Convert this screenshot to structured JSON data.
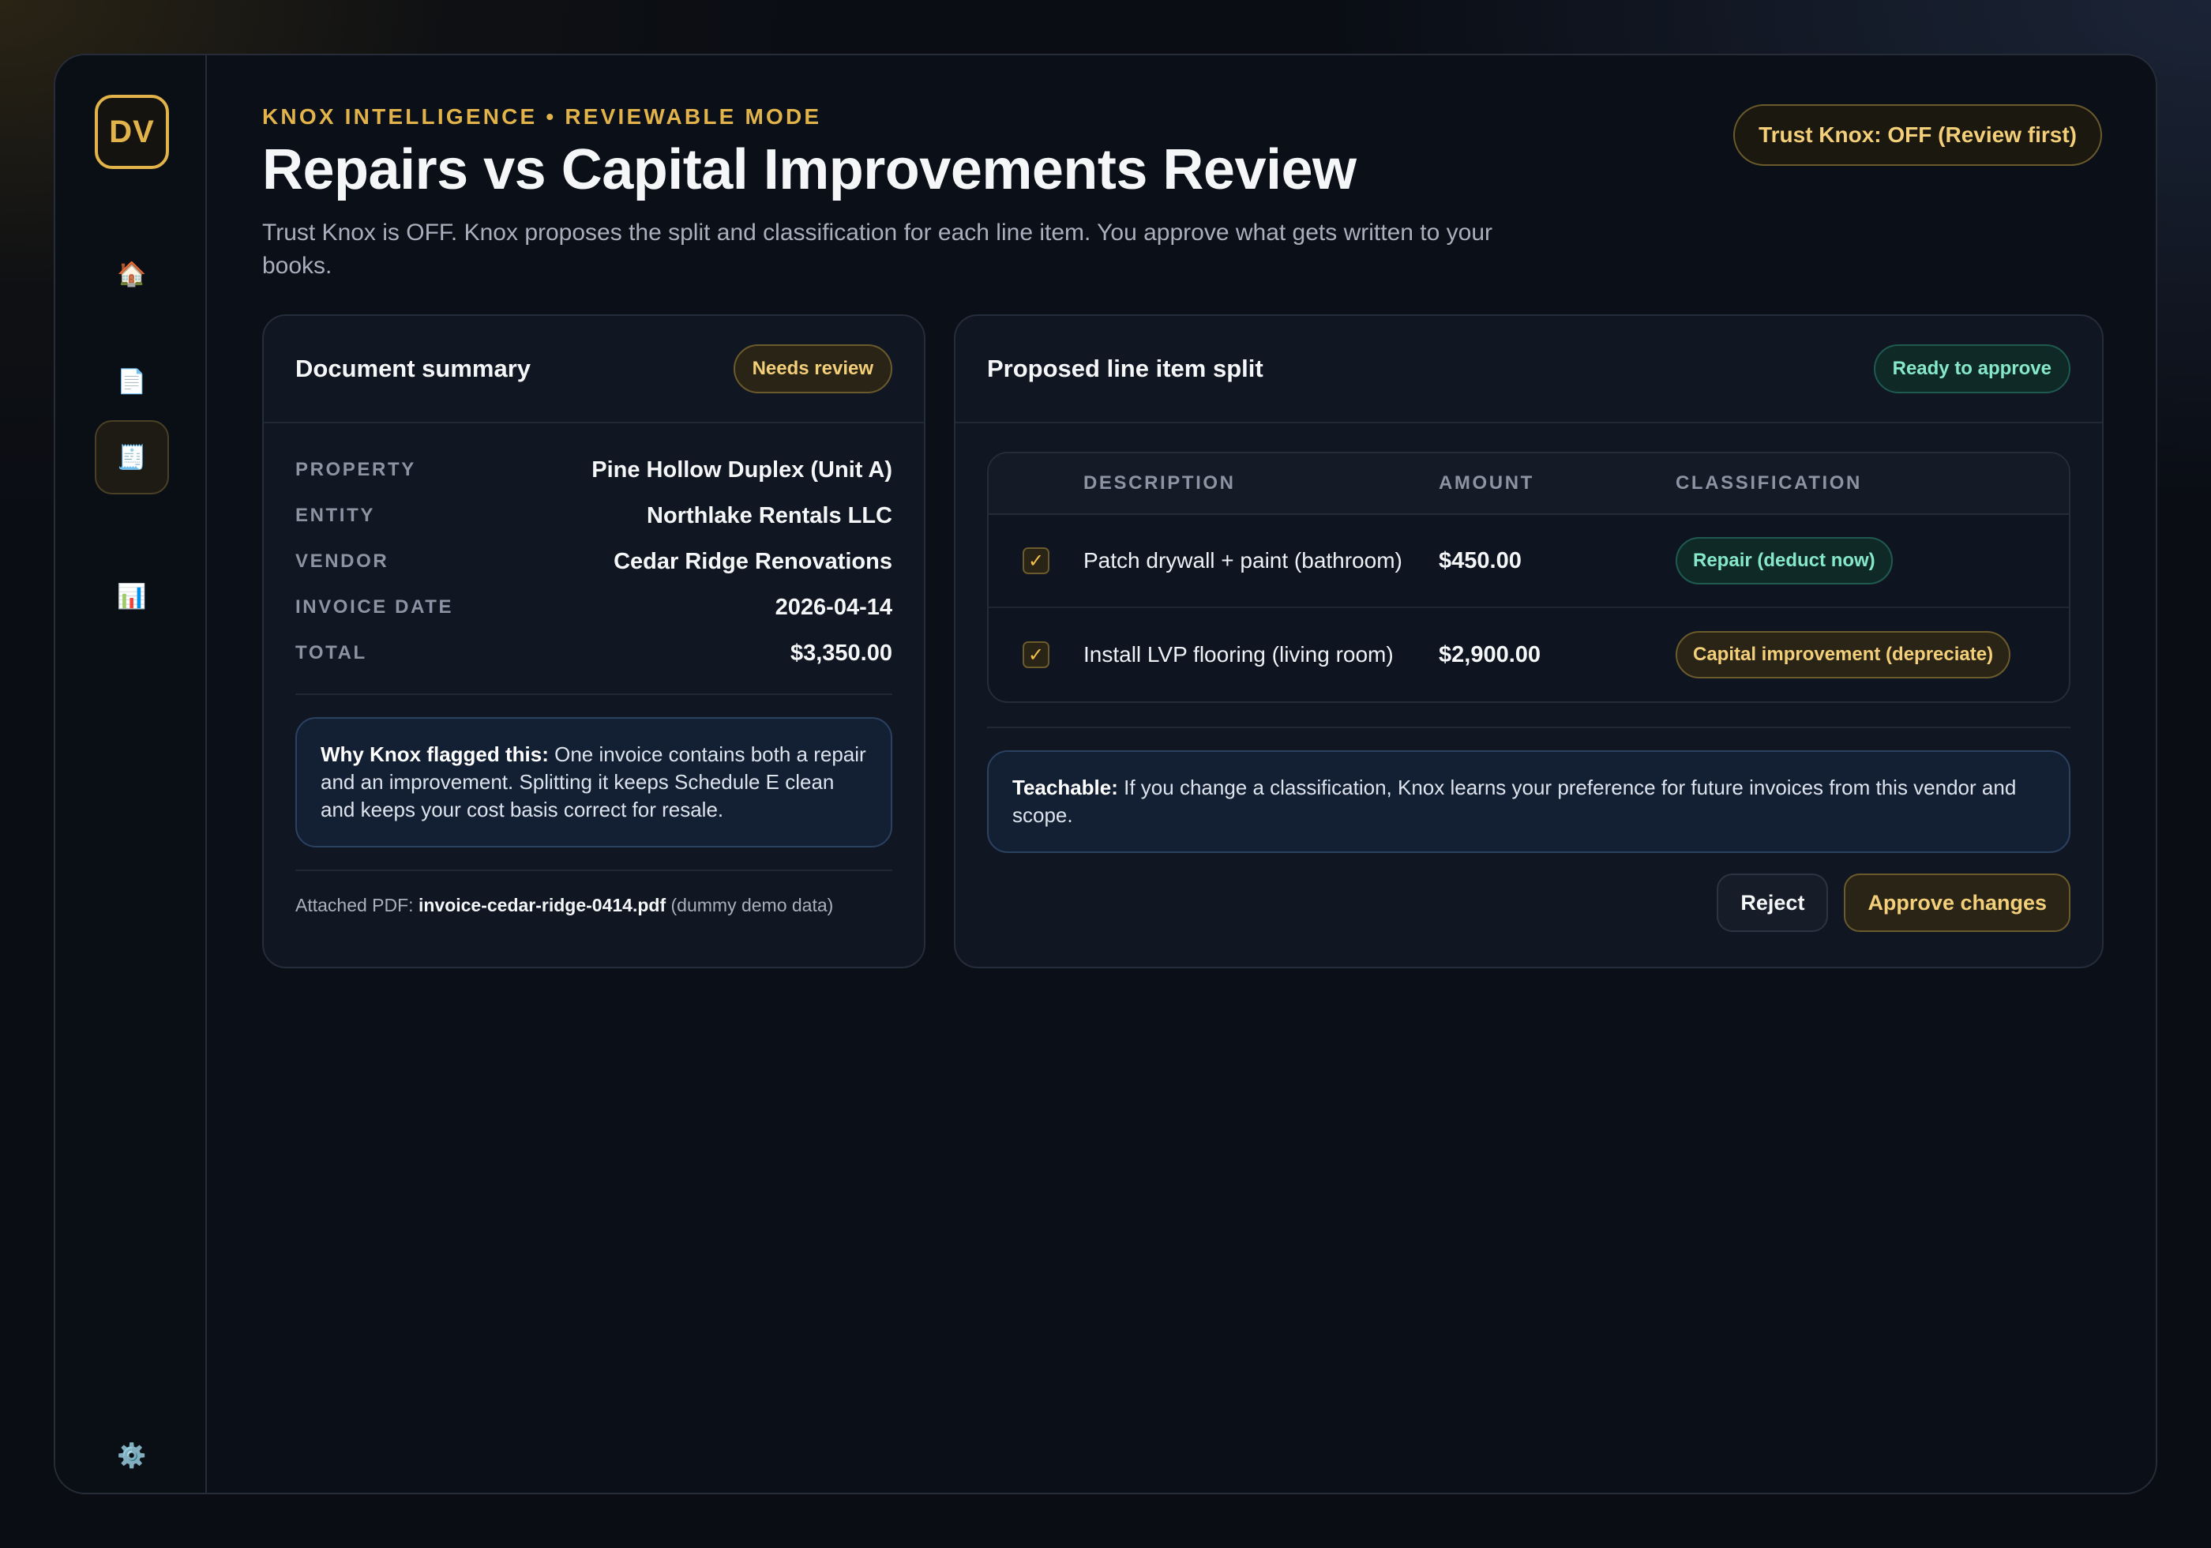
{
  "sidebar": {
    "logo": "DV",
    "items": [
      {
        "name": "home",
        "glyph": "🏠"
      },
      {
        "name": "documents",
        "glyph": "📄"
      },
      {
        "name": "invoices",
        "glyph": "🧾"
      },
      {
        "name": "reports",
        "glyph": "📊"
      }
    ],
    "settings_glyph": "⚙️"
  },
  "header": {
    "eyebrow": "KNOX INTELLIGENCE • REVIEWABLE MODE",
    "title": "Repairs vs Capital Improvements Review",
    "subtitle": "Trust Knox is OFF. Knox proposes the split and classification for each line item. You approve what gets written to your books.",
    "trust_toggle": "Trust Knox: OFF (Review first)"
  },
  "summary": {
    "title": "Document summary",
    "badge": "Needs review",
    "fields": [
      {
        "key": "PROPERTY",
        "value": "Pine Hollow Duplex (Unit A)"
      },
      {
        "key": "ENTITY",
        "value": "Northlake Rentals LLC"
      },
      {
        "key": "VENDOR",
        "value": "Cedar Ridge Renovations"
      },
      {
        "key": "INVOICE DATE",
        "value": "2026-04-14"
      },
      {
        "key": "TOTAL",
        "value": "$3,350.00"
      }
    ],
    "why_label": "Why Knox flagged this:",
    "why_text": " One invoice contains both a repair and an improvement. Splitting it keeps Schedule E clean and keeps your cost basis correct for resale.",
    "attached_label": "Attached PDF: ",
    "attached_file": "invoice-cedar-ridge-0414.pdf",
    "attached_note": " (dummy demo data)"
  },
  "split": {
    "title": "Proposed line item split",
    "badge": "Ready to approve",
    "columns": [
      "DESCRIPTION",
      "AMOUNT",
      "CLASSIFICATION"
    ],
    "rows": [
      {
        "checked": true,
        "description": "Patch drywall + paint (bathroom)",
        "amount": "$450.00",
        "classification": "Repair (deduct now)",
        "kind": "repair"
      },
      {
        "checked": true,
        "description": "Install LVP flooring (living room)",
        "amount": "$2,900.00",
        "classification": "Capital improvement (depreciate)",
        "kind": "capital"
      }
    ],
    "teach_label": "Teachable:",
    "teach_text": " If you change a classification, Knox learns your preference for future invoices from this vendor and scope.",
    "reject_label": "Reject",
    "approve_label": "Approve changes"
  },
  "colors": {
    "accent": "#e2b34a",
    "success": "#86e8c9",
    "background": "#0a0d14"
  }
}
